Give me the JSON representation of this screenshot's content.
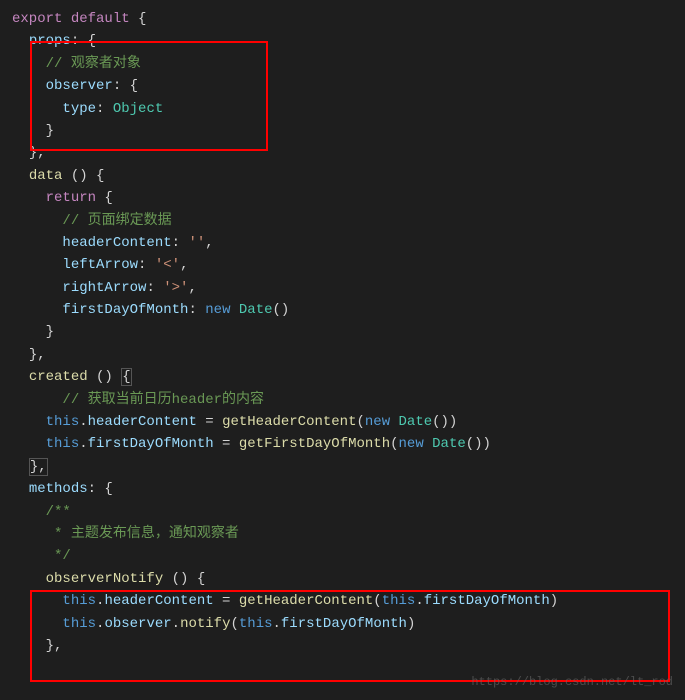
{
  "code": {
    "l1": {
      "export": "export",
      "default": "default",
      "brace": " {"
    },
    "l2": {
      "indent": "  ",
      "props": "props",
      "colon": ": {"
    },
    "l3": {
      "indent": "    ",
      "comment": "// 观察者对象"
    },
    "l4": {
      "indent": "    ",
      "observer": "observer",
      "colon": ": {"
    },
    "l5": {
      "indent": "      ",
      "type": "type",
      "colon": ": ",
      "object": "Object"
    },
    "l6": {
      "indent": "    ",
      "brace": "}"
    },
    "l7": {
      "indent": "  ",
      "brace": "},"
    },
    "l8": {
      "indent": "  ",
      "data": "data",
      "paren": " () {"
    },
    "l9": {
      "indent": "    ",
      "return": "return",
      "brace": " {"
    },
    "l10": {
      "indent": "      ",
      "comment": "// 页面绑定数据"
    },
    "l11": {
      "indent": "      ",
      "key": "headerContent",
      "colon": ": ",
      "val": "''",
      "comma": ","
    },
    "l12": {
      "indent": "      ",
      "key": "leftArrow",
      "colon": ": ",
      "val": "'<'",
      "comma": ","
    },
    "l13": {
      "indent": "      ",
      "key": "rightArrow",
      "colon": ": ",
      "val": "'>'",
      "comma": ","
    },
    "l14": {
      "indent": "      ",
      "key": "firstDayOfMonth",
      "colon": ": ",
      "new": "new",
      "date": " Date",
      "paren": "()"
    },
    "l15": {
      "indent": "    ",
      "brace": "}"
    },
    "l16": {
      "indent": "  ",
      "brace": "},"
    },
    "l17": {
      "indent": "  ",
      "created": "created",
      "paren": " () ",
      "brace": "{"
    },
    "l18": {
      "indent": "      ",
      "comment": "// 获取当前日历header的内容"
    },
    "l19": {
      "indent": "    ",
      "this": "this",
      "dot": ".",
      "prop": "headerContent",
      "eq": " = ",
      "fn": "getHeaderContent",
      "open": "(",
      "new": "new",
      "date": " Date",
      "close": "())"
    },
    "l20": {
      "indent": "    ",
      "this": "this",
      "dot": ".",
      "prop": "firstDayOfMonth",
      "eq": " = ",
      "fn": "getFirstDayOfMonth",
      "open": "(",
      "new": "new",
      "date": " Date",
      "close": "())"
    },
    "l21": {
      "indent": "  ",
      "brace": "},"
    },
    "l22": {
      "indent": "  ",
      "methods": "methods",
      "colon": ": {"
    },
    "l23": {
      "indent": "    ",
      "comment": "/**"
    },
    "l24": {
      "indent": "     ",
      "comment": "* 主题发布信息，通知观察者"
    },
    "l25": {
      "indent": "     ",
      "comment": "*/"
    },
    "l26": {
      "indent": "    ",
      "fn": "observerNotify",
      "paren": " () {"
    },
    "l27": {
      "indent": "      ",
      "this": "this",
      "dot": ".",
      "prop": "headerContent",
      "eq": " = ",
      "fn2": "getHeaderContent",
      "open": "(",
      "this2": "this",
      "dot2": ".",
      "prop2": "firstDayOfMonth",
      "close": ")"
    },
    "l28": {
      "indent": "      ",
      "this": "this",
      "dot": ".",
      "prop": "observer",
      "dot2": ".",
      "fn": "notify",
      "open": "(",
      "this2": "this",
      "dot3": ".",
      "prop2": "firstDayOfMonth",
      "close": ")"
    },
    "l29": {
      "indent": "    ",
      "brace": "},"
    }
  },
  "watermark": "https://blog.csdn.net/lt_rod"
}
